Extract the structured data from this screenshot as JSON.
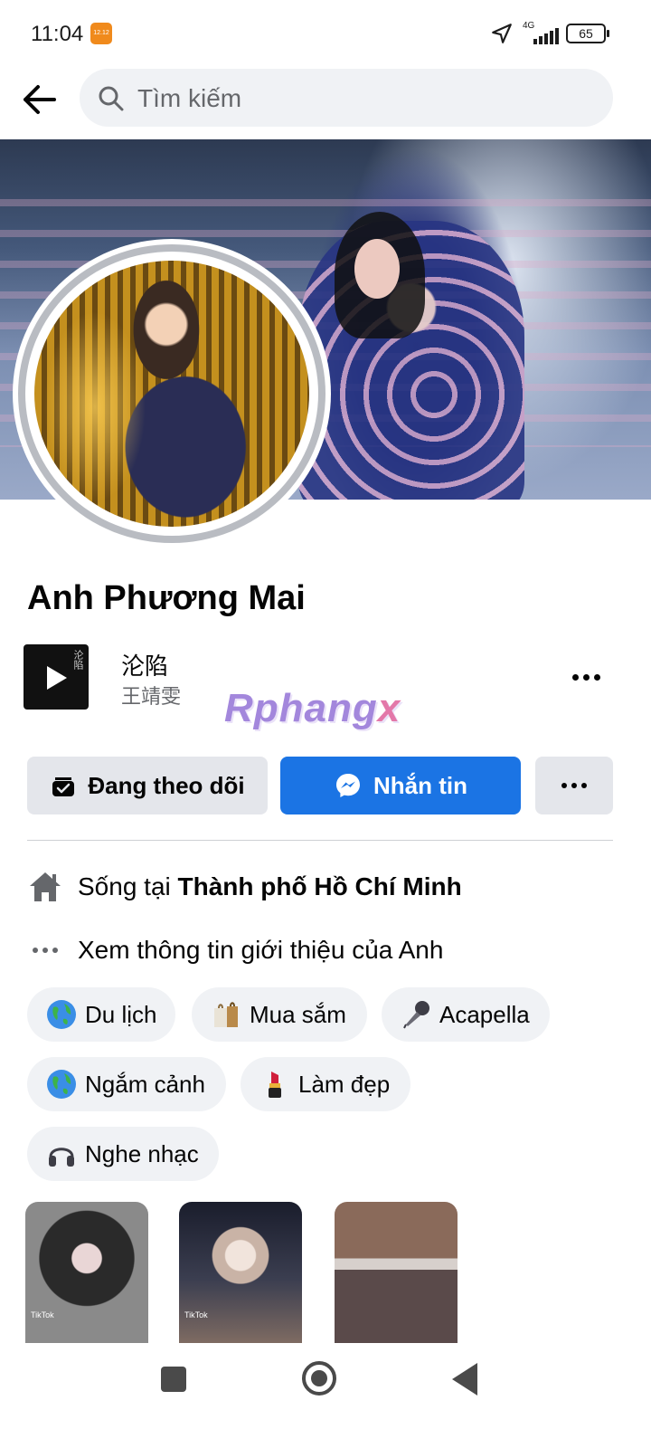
{
  "status_bar": {
    "time": "11:04",
    "network": "4G",
    "battery": "65"
  },
  "search": {
    "placeholder": "Tìm kiếm"
  },
  "profile": {
    "name": "Anh Phương Mai"
  },
  "music": {
    "title": "沦陷",
    "artist": "王靖雯",
    "cover_text": "沦陷"
  },
  "watermark": {
    "main": "Rphang",
    "tail": "x"
  },
  "actions": {
    "follow_label": "Đang theo dõi",
    "message_label": "Nhắn tin"
  },
  "info": {
    "lives_prefix": "Sống tại ",
    "lives_city": "Thành phố Hồ Chí Minh",
    "about_label": "Xem thông tin giới thiệu của Anh"
  },
  "interests": [
    {
      "label": "Du lịch",
      "icon": "globe-icon"
    },
    {
      "label": "Mua sắm",
      "icon": "shopping-bag-icon"
    },
    {
      "label": "Acapella",
      "icon": "microphone-icon"
    },
    {
      "label": "Ngắm cảnh",
      "icon": "globe-icon"
    },
    {
      "label": "Làm đẹp",
      "icon": "lipstick-icon"
    },
    {
      "label": "Nghe nhạc",
      "icon": "headphones-icon"
    }
  ],
  "stories": [
    {
      "badge": "TikTok"
    },
    {
      "badge": "TikTok"
    },
    {
      "badge": ""
    }
  ],
  "colors": {
    "primary": "#1b74e4",
    "secondary_button": "#e4e6eb",
    "chip_bg": "#f0f2f5",
    "muted_text": "#65676b"
  }
}
